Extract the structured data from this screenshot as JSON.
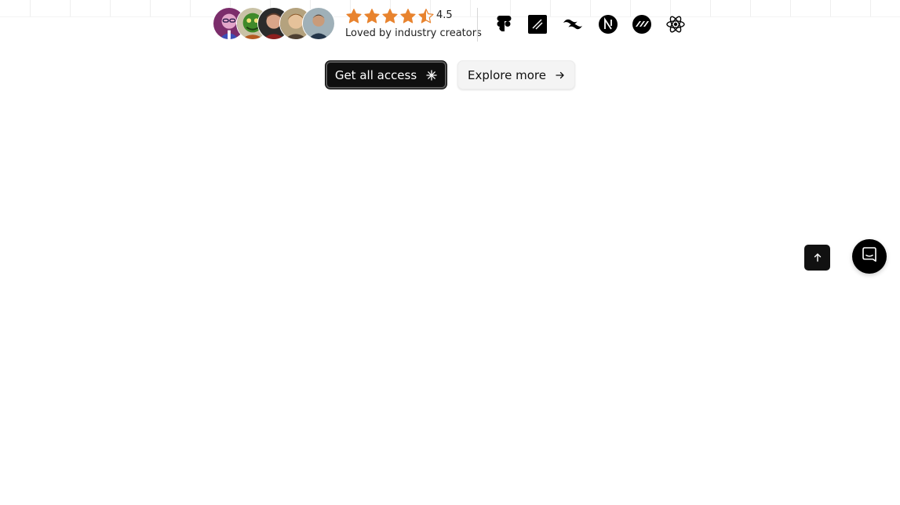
{
  "social_proof": {
    "avatars": [
      {
        "name": "avatar-1",
        "bg": "#7b2d6b"
      },
      {
        "name": "avatar-2",
        "bg": "#3f8a2a"
      },
      {
        "name": "avatar-3",
        "bg": "#2b2b2b"
      },
      {
        "name": "avatar-4",
        "bg": "#8a6a44"
      },
      {
        "name": "avatar-5",
        "bg": "#5f7482"
      }
    ],
    "rating": {
      "value": "4.5",
      "stars_filled": 4.5,
      "stars_total": 5,
      "star_color": "#e8832e",
      "caption": "Loved by industry creators"
    }
  },
  "tech_icons": [
    "figma-icon",
    "framer-icon",
    "tailwind-icon",
    "nextjs-icon",
    "motion-icon",
    "react-icon"
  ],
  "actions": {
    "primary": {
      "label": "Get all access",
      "icon": "asterisk-icon"
    },
    "secondary": {
      "label": "Explore more",
      "icon": "arrow-right-icon"
    }
  },
  "floating": {
    "scroll_top_icon": "arrow-up-icon",
    "chat_icon": "chat-icon"
  },
  "colors": {
    "primary_bg": "#0f0f0f",
    "secondary_bg": "#f4f4f4",
    "star": "#e8832e"
  }
}
